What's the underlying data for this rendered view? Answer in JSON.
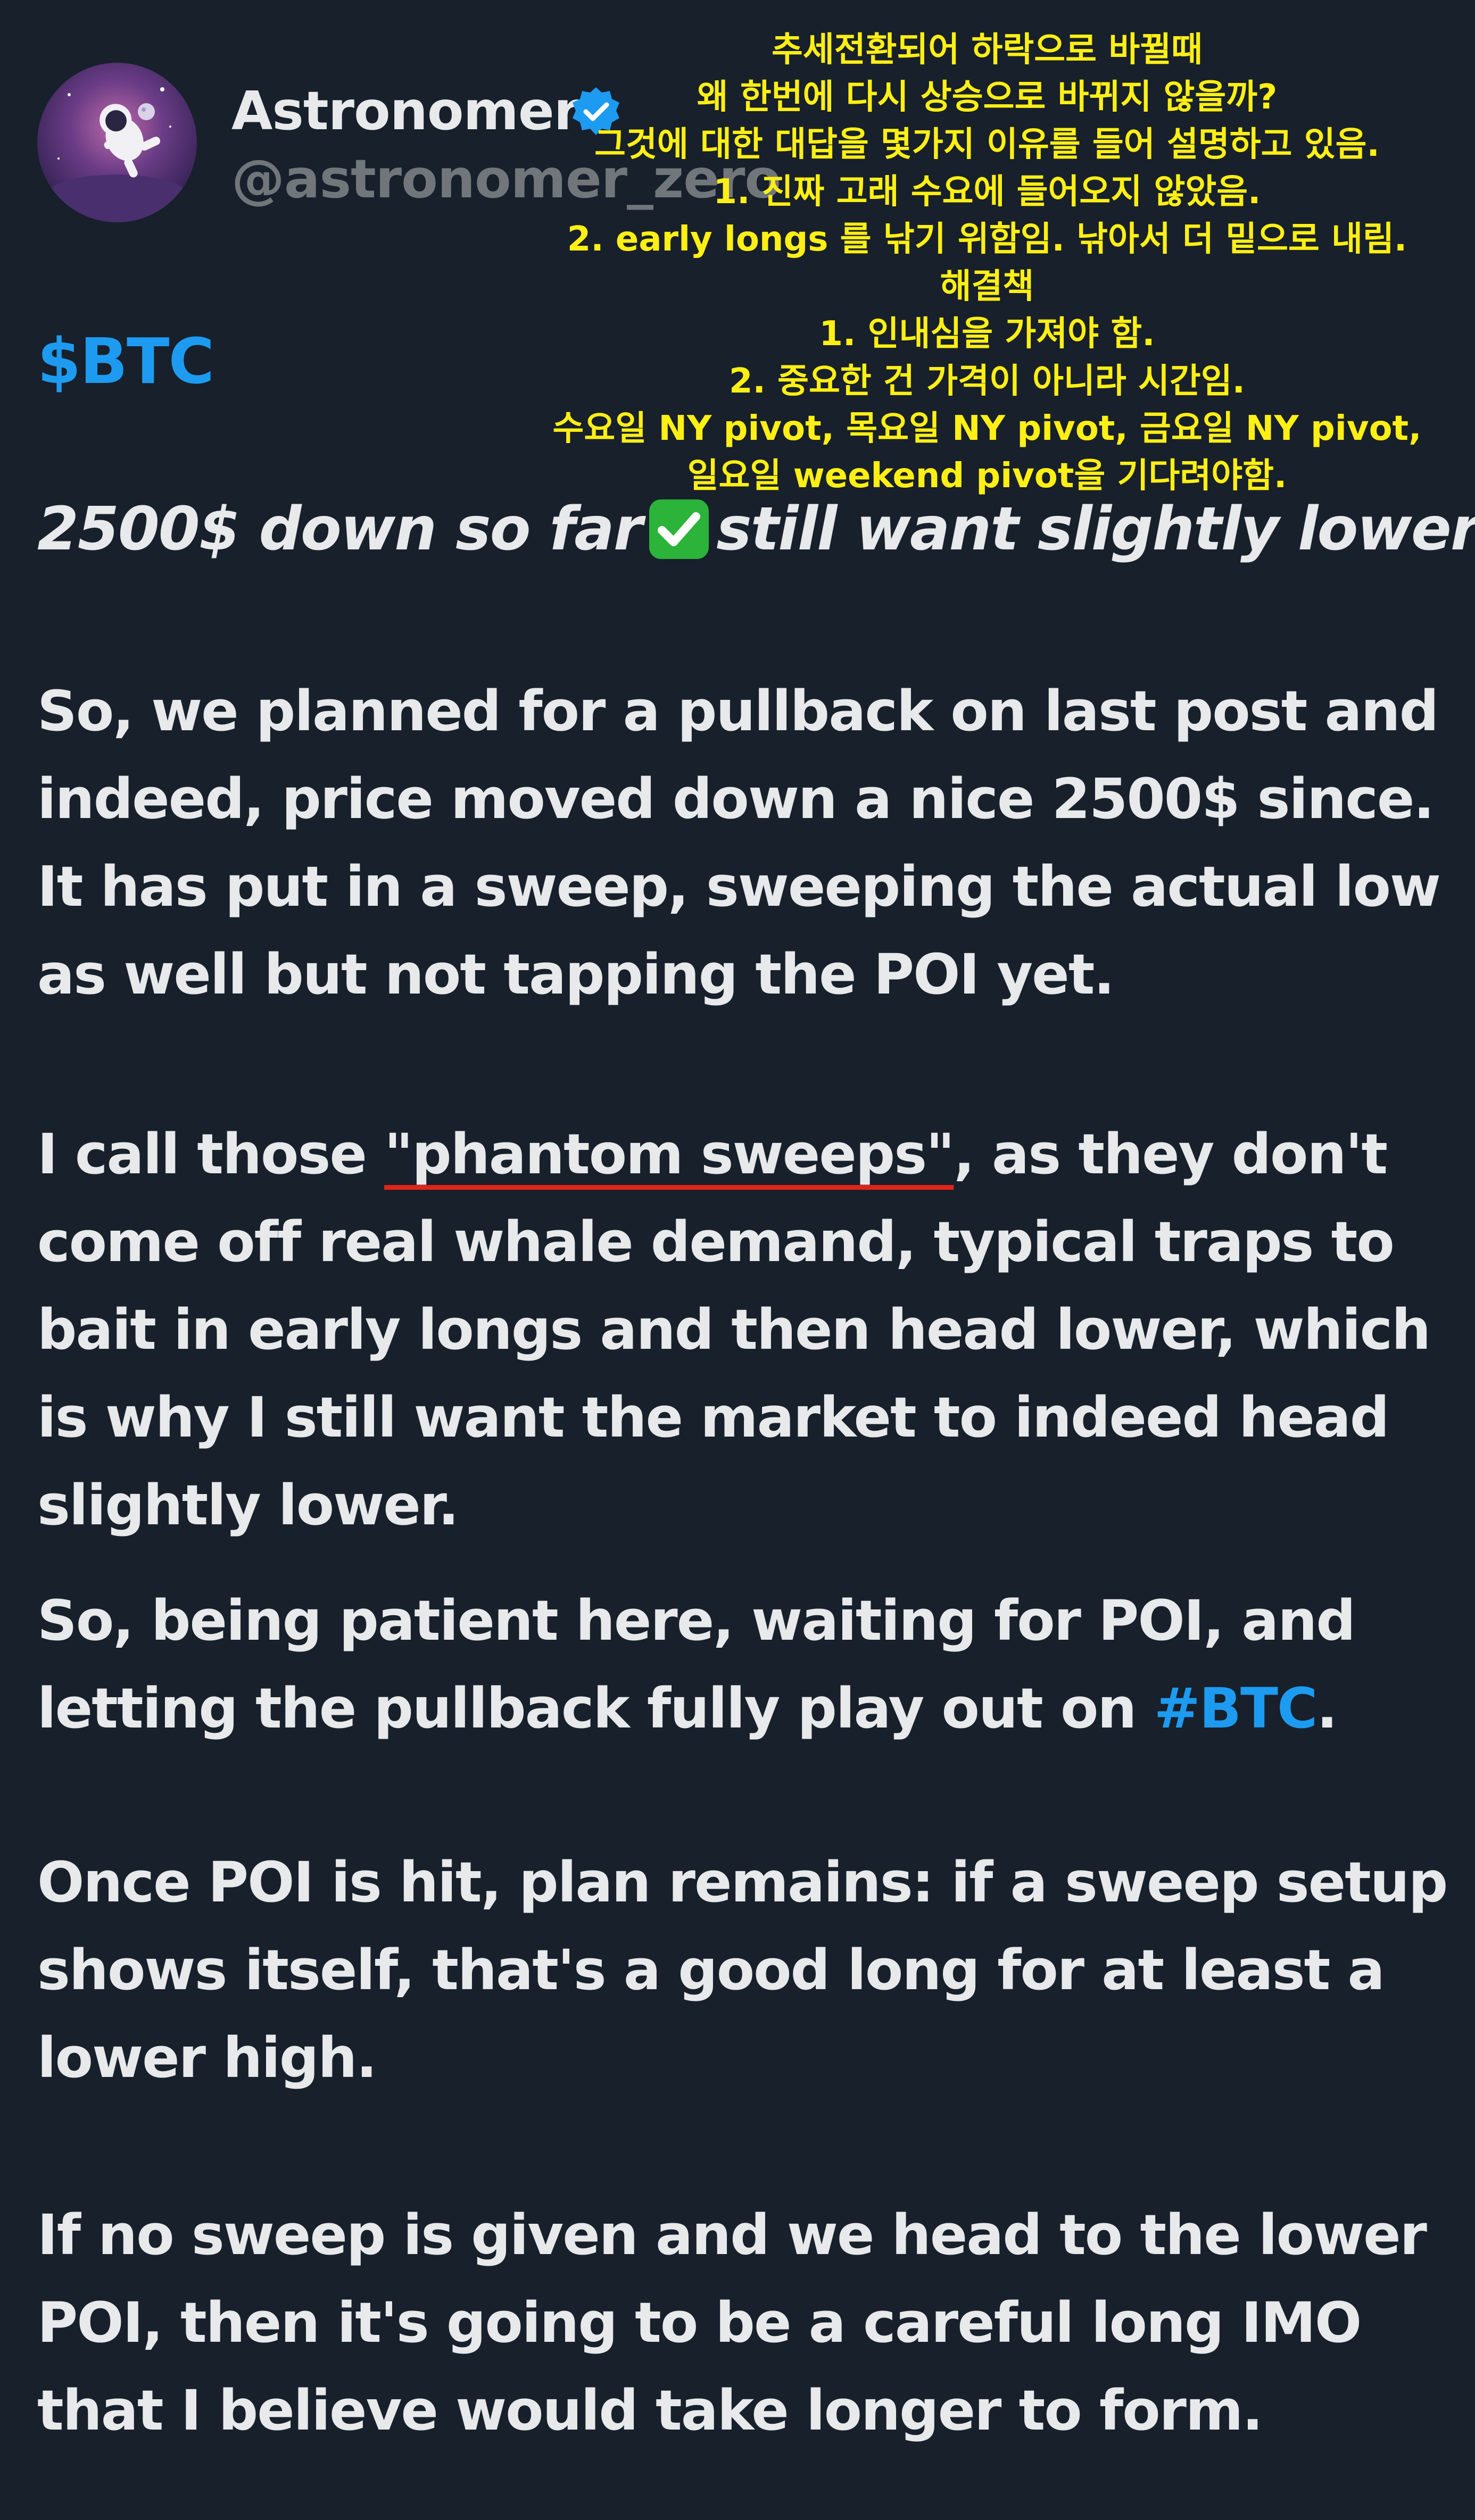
{
  "profile": {
    "display_name": "Astronomer",
    "handle": "@astronomer_zero",
    "verified": true
  },
  "tweet": {
    "cashtag": "$BTC",
    "headline_part1": "2500$ down so far",
    "headline_part2": "still want slightly lower",
    "p1": [
      "So, we planned for a pullback on last post and",
      "indeed, price moved down a nice 2500$ since.",
      "It has put in a sweep, sweeping the actual low",
      "as well but not tapping the POI yet."
    ],
    "p2_l1_before": "I call those ",
    "p2_l1_underlined": "\"phantom sweeps\"",
    "p2_l1_after": ", as they don't",
    "p2_rest": [
      "come off real whale demand, typical traps to",
      "bait in early longs and then head lower, which",
      "is why I still want the market to indeed head",
      "slightly lower."
    ],
    "p3_l1": "So, being patient here, waiting for POI, and",
    "p3_l2_before": "letting the pullback fully play out on ",
    "p3_l2_hashtag": "#BTC",
    "p3_l2_after": ".",
    "p4": [
      "Once POI is hit, plan remains: if a sweep setup",
      "shows itself, that's a good long for at least a",
      "lower high."
    ],
    "p5": [
      "If no sweep is given and we head to the lower",
      "POI, then it's going to be a careful long IMO",
      "that I believe would take longer to form."
    ]
  },
  "annotation": {
    "lines": [
      "추세전환되어 하락으로 바뀔때",
      "왜 한번에 다시 상승으로 바뀌지 않을까?",
      "그것에 대한 대답을 몇가지 이유를 들어 설명하고 있음.",
      "1. 진짜 고래 수요에 들어오지 않았음.",
      "2. early longs 를 낚기 위함임. 낚아서 더 밑으로 내림.",
      "해결책",
      "1. 인내심을 가져야 함.",
      "2. 중요한 건 가격이 아니라 시간임.",
      "수요일 NY pivot, 목요일 NY pivot, 금요일 NY pivot,",
      "일요일 weekend pivot을 기다려야함."
    ]
  },
  "icons": {
    "avatar": "astronaut-avatar-icon",
    "verified": "verified-badge-icon",
    "check": "check-mark-emoji-icon"
  },
  "colors": {
    "background": "#16202b",
    "text": "#e7e9ea",
    "muted": "#71767b",
    "link": "#1d9bf0",
    "annotation": "#ffef14",
    "underline": "#e0241a",
    "check_green": "#2bb33a"
  }
}
